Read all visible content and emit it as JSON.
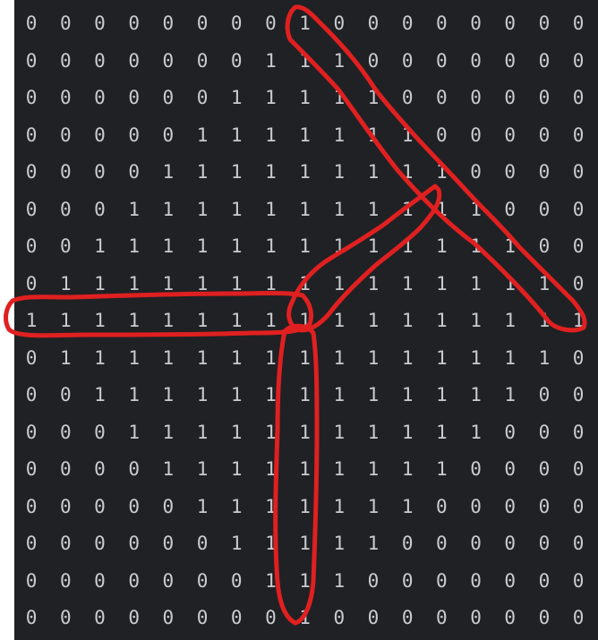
{
  "grid": {
    "rows": [
      "00000000100000000",
      "00000001110000000",
      "00000011111000000",
      "00000111111100000",
      "00001111111110000",
      "00011111111111000",
      "00111111111111100",
      "01111111111111110",
      "11111111111111111",
      "01111111111111110",
      "00111111111111100",
      "00011111111111000",
      "00001111111110000",
      "00000111111100000",
      "00000011111000000",
      "00000001110000000",
      "00000000100000000"
    ]
  },
  "annotations": [
    {
      "name": "red-outline-diagonal-top-to-right",
      "color": "#e02020"
    },
    {
      "name": "red-outline-diagonal-center-to-top-right",
      "color": "#e02020"
    },
    {
      "name": "red-outline-left-horizontal",
      "color": "#e02020"
    },
    {
      "name": "red-outline-vertical-center-down",
      "color": "#e02020"
    }
  ],
  "colors": {
    "background": "#202124",
    "digit": "#c9cbd0",
    "annotation": "#e02020"
  }
}
